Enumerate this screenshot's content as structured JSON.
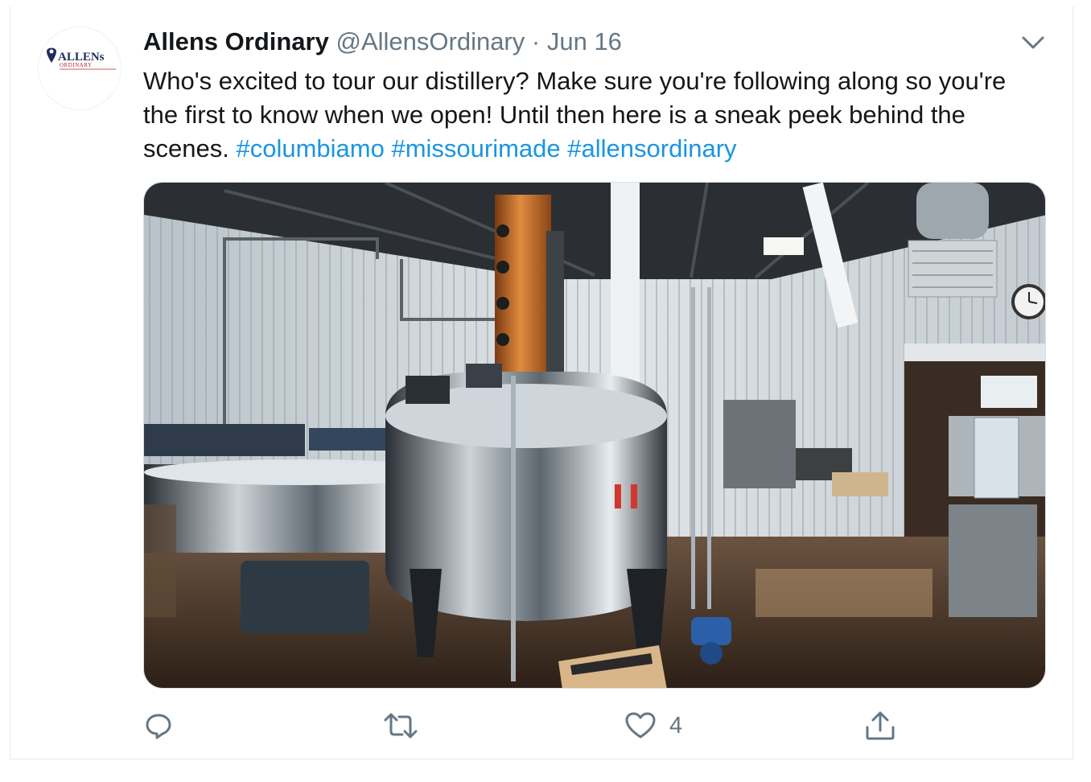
{
  "tweet": {
    "display_name": "Allens Ordinary",
    "handle": "@AllensOrdinary",
    "separator": "·",
    "date": "Jun 16",
    "text_before": "Who's excited to tour our distillery? Make sure you're following along so you're the first to know when we open! Until then here is a sneak peek behind the scenes.",
    "hashtags": [
      "#columbiamo",
      "#missourimade",
      "#allensordinary"
    ],
    "avatar": {
      "logo_text_top": "ALLENs",
      "logo_text_bottom": "ORDINARY",
      "colors": {
        "navy": "#1f2d5c",
        "red": "#b2242a"
      }
    },
    "media": {
      "icon": "photo",
      "subject": "distillery interior with copper column still and stainless steel tanks"
    },
    "actions": {
      "reply": {
        "icon": "reply-icon"
      },
      "retweet": {
        "icon": "retweet-icon"
      },
      "like": {
        "icon": "heart-icon",
        "count": "4"
      },
      "share": {
        "icon": "share-icon"
      }
    }
  },
  "colors": {
    "text": "#14171a",
    "secondary": "#657786",
    "link": "#1b95e0",
    "border": "#e6ecf0"
  }
}
